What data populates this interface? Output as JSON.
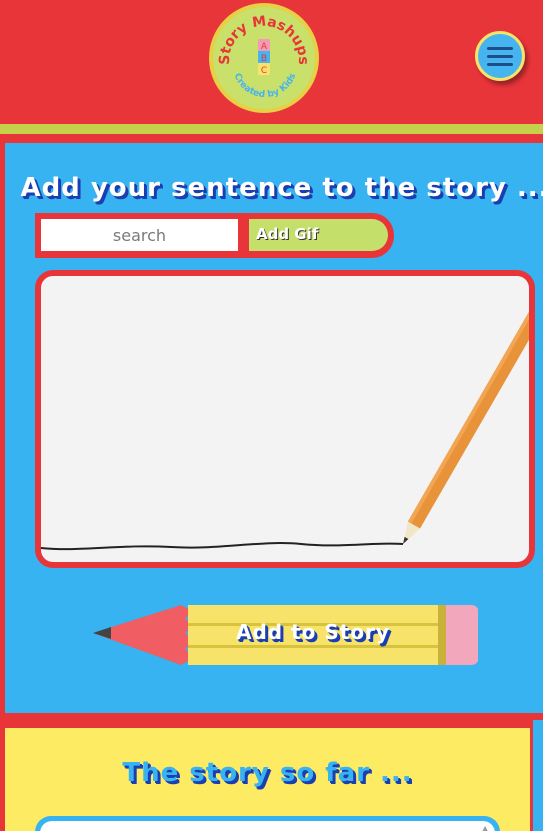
{
  "header": {
    "logo_text_top": "Story Mashups",
    "logo_text_bottom": "Created by Kids",
    "logo_blocks": [
      "A",
      "B",
      "C"
    ],
    "menu_icon": "hamburger-icon"
  },
  "compose": {
    "title": "Add your sentence to the story ...",
    "search": {
      "placeholder": "search",
      "value": ""
    },
    "add_gif_label": "Add Gif",
    "add_to_story_label": "Add to Story"
  },
  "story": {
    "title": "The story so far ..."
  },
  "colors": {
    "red": "#e8353a",
    "blue": "#36b3f0",
    "yellow": "#fdeb63",
    "green": "#c5df6b",
    "title_shadow": "#1b3fb0"
  }
}
